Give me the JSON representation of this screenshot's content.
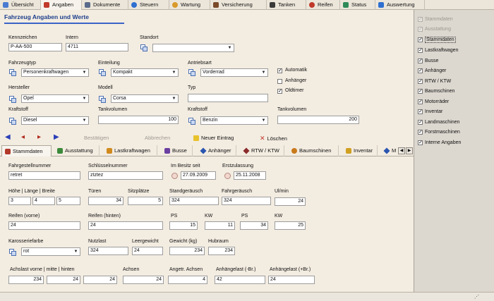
{
  "top_tabs": [
    {
      "label": "Übersicht",
      "icon": "overview-icon",
      "color": "#4a7bd0"
    },
    {
      "label": "Angaben",
      "icon": "car-icon",
      "color": "#c0392b"
    },
    {
      "label": "Dokumente",
      "icon": "document-icon",
      "color": "#5b6b8a"
    },
    {
      "label": "Steuern",
      "icon": "globe-icon",
      "color": "#2f6fd0"
    },
    {
      "label": "Wartung",
      "icon": "wrench-icon",
      "color": "#d99a2b"
    },
    {
      "label": "Versicherung",
      "icon": "insurance-icon",
      "color": "#7a4a2a"
    },
    {
      "label": "Tanken",
      "icon": "fuel-icon",
      "color": "#3a3a3a"
    },
    {
      "label": "Reifen",
      "icon": "tire-icon",
      "color": "#c0392b"
    },
    {
      "label": "Status",
      "icon": "status-icon",
      "color": "#2e8b57"
    },
    {
      "label": "Auswertung",
      "icon": "chart-icon",
      "color": "#2f6fd0"
    }
  ],
  "header": {
    "title": "Fahrzeug Angaben und Werte"
  },
  "form": {
    "kennzeichen": {
      "label": "Kennzeichen",
      "value": "P-AA-500"
    },
    "intern": {
      "label": "Intern",
      "value": "4711"
    },
    "standort": {
      "label": "Standort",
      "value": ""
    },
    "fahrzeugtyp": {
      "label": "Fahrzeugtyp",
      "value": "Personenkraftwagen"
    },
    "einteilung": {
      "label": "Einteilung",
      "value": "Kompakt"
    },
    "antriebsart": {
      "label": "Antriebsart",
      "value": "Vorderrad"
    },
    "hersteller": {
      "label": "Hersteller",
      "value": "Opel"
    },
    "modell": {
      "label": "Modell",
      "value": "Corsa"
    },
    "typ": {
      "label": "Typ",
      "value": ""
    },
    "kraftstoff1": {
      "label": "Kraftstoff",
      "value": "Diesel"
    },
    "tankvolumen1": {
      "label": "Tankvolumen",
      "value": "100"
    },
    "kraftstoff2": {
      "label": "Kraftstoff",
      "value": "Benzin"
    },
    "tankvolumen2": {
      "label": "Tankvolumen",
      "value": "200"
    },
    "checks": [
      {
        "label": "Automatik",
        "checked": true
      },
      {
        "label": "Anhänger",
        "checked": false
      },
      {
        "label": "Oldtimer",
        "checked": true
      }
    ]
  },
  "actions": {
    "confirm": "Bestätigen",
    "cancel": "Abbrechen",
    "new": "Neuer Eintrag",
    "delete": "Löschen"
  },
  "sub_tabs": [
    {
      "label": "Stammdaten"
    },
    {
      "label": "Ausstattung"
    },
    {
      "label": "Lastkraftwagen"
    },
    {
      "label": "Busse"
    },
    {
      "label": "Anhänger"
    },
    {
      "label": "RTW / KTW"
    },
    {
      "label": "Baumschinen"
    },
    {
      "label": "Inventar"
    },
    {
      "label": "M"
    }
  ],
  "detail": {
    "fahrgestell": {
      "label": "Fahrgestellnummer",
      "value": "retret"
    },
    "schluessel": {
      "label": "Schlüsselnummer",
      "value": "ztztez"
    },
    "besitz": {
      "label": "Im Besitz seit",
      "value": "27.09.2009"
    },
    "erstzulassung": {
      "label": "Erstzulassung",
      "value": "25.11.2008"
    },
    "hlb": {
      "label": "Höhe | Länge | Breite",
      "values": [
        "3",
        "4",
        "5"
      ]
    },
    "tueren": {
      "label": "Türen",
      "value": "34"
    },
    "sitzplaetze": {
      "label": "Sitzplätze",
      "value": "5"
    },
    "standgeraeusch": {
      "label": "Standgeräusch",
      "value": "324"
    },
    "fahrgeraeusch": {
      "label": "Fahrgeräusch",
      "value": "324"
    },
    "ulmin": {
      "label": "Ul/min",
      "value": "24"
    },
    "reifen_vorne": {
      "label": "Reifen (vorne)",
      "value": "24"
    },
    "reifen_hinten": {
      "label": "Reifen (hinten)",
      "value": "24"
    },
    "ps1": {
      "label": "PS",
      "value": "15"
    },
    "kw1": {
      "label": "KW",
      "value": "11"
    },
    "ps2": {
      "label": "PS",
      "value": "34"
    },
    "kw2": {
      "label": "KW",
      "value": "25"
    },
    "farbe": {
      "label": "Karosseriefarbe",
      "value": "rot"
    },
    "nutzlast": {
      "label": "Nutzlast",
      "value": "324"
    },
    "leergewicht": {
      "label": "Leergewicht",
      "value": "24"
    },
    "gewicht": {
      "label": "Gewicht (kg)",
      "value": "234"
    },
    "hubraum": {
      "label": "Hubraum",
      "value": "234"
    },
    "achslast": {
      "label": "Achslast vorne | mitte | hinten",
      "values": [
        "234",
        "24",
        "24"
      ]
    },
    "achsen": {
      "label": "Achsen",
      "value": "24"
    },
    "angetr_achsen": {
      "label": "Angetr. Achsen",
      "value": "4"
    },
    "anhlast_minus": {
      "label": "Anhängelast (-Br.)",
      "value": "42"
    },
    "anhlast_plus": {
      "label": "Anhängelast (+Br.)",
      "value": "24"
    }
  },
  "right_panel": [
    {
      "label": "Stammdaten",
      "checked": true,
      "disabled": true
    },
    {
      "label": "Ausstattung",
      "checked": true,
      "disabled": true
    },
    {
      "label": "Stammdaten",
      "checked": true,
      "disabled": false,
      "focused": true
    },
    {
      "label": "Lastkraftwagen",
      "checked": true,
      "disabled": false
    },
    {
      "label": "Busse",
      "checked": true,
      "disabled": false
    },
    {
      "label": "Anhänger",
      "checked": true,
      "disabled": false
    },
    {
      "label": "RTW / KTW",
      "checked": true,
      "disabled": false
    },
    {
      "label": "Baumschinen",
      "checked": true,
      "disabled": false
    },
    {
      "label": "Motorräder",
      "checked": true,
      "disabled": false
    },
    {
      "label": "Inventar",
      "checked": true,
      "disabled": false
    },
    {
      "label": "Landmaschinen",
      "checked": true,
      "disabled": false
    },
    {
      "label": "Forstmaschinen",
      "checked": true,
      "disabled": false
    },
    {
      "label": "Interne Angaben",
      "checked": true,
      "disabled": false
    }
  ]
}
